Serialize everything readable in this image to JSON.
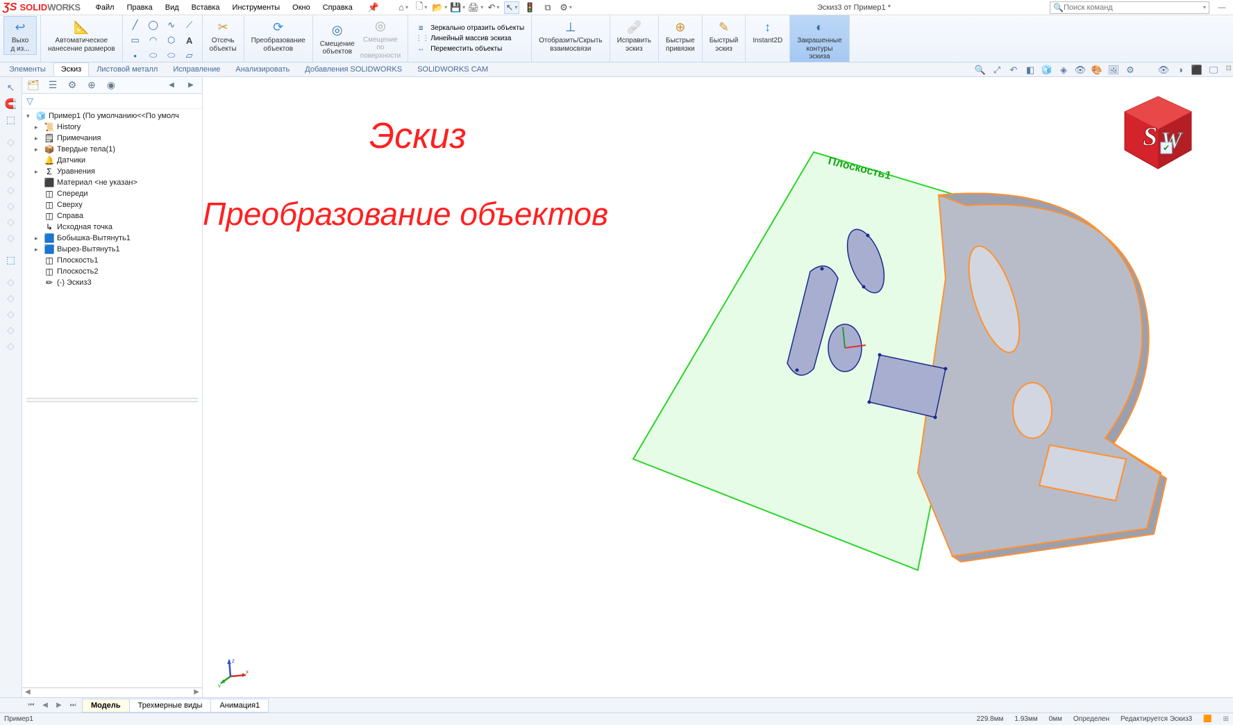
{
  "app": {
    "logo_solid": "SOLID",
    "logo_works": "WORKS"
  },
  "menu": {
    "file": "Файл",
    "edit": "Правка",
    "view": "Вид",
    "insert": "Вставка",
    "tools": "Инструменты",
    "window": "Окно",
    "help": "Справка"
  },
  "doc_title": "Эскиз3 от Пример1 *",
  "search": {
    "placeholder": "Поиск команд"
  },
  "ribbon": {
    "exit_sketch": "Выхо\nд из...",
    "smart_dim": "Автоматическое\nнанесение размеров",
    "trim": "Отсечь\nобъекты",
    "convert": "Преобразование\nобъектов",
    "offset": "Смещение\nобъектов",
    "offset_surf": "Смещение\nпо\nповерхности",
    "mirror": "Зеркально отразить объекты",
    "linear_pattern": "Линейный массив эскиза",
    "move": "Переместить объекты",
    "show_hide": "Отобразить/Скрыть\nвзаимосвязи",
    "repair": "Исправить\nэскиз",
    "quick_snaps": "Быстрые\nпривязки",
    "rapid_sketch": "Быстрый\nэскиз",
    "instant2d": "Instant2D",
    "shaded_contours": "Закрашенные\nконтуры\nэскиза"
  },
  "cmd_tabs": [
    "Элементы",
    "Эскиз",
    "Листовой металл",
    "Исправление",
    "Анализировать",
    "Добавления SOLIDWORKS",
    "SOLIDWORKS CAM"
  ],
  "active_cmd_tab": 1,
  "fm": {
    "root": "Пример1  (По умолчанию<<По умолч",
    "items": [
      {
        "icon": "📜",
        "label": "History",
        "toggle": "▸"
      },
      {
        "icon": "🗒",
        "label": "Примечания",
        "toggle": "▸"
      },
      {
        "icon": "📦",
        "label": "Твердые тела(1)",
        "toggle": "▸"
      },
      {
        "icon": "🔔",
        "label": "Датчики",
        "toggle": ""
      },
      {
        "icon": "Σ",
        "label": "Уравнения",
        "toggle": "▸"
      },
      {
        "icon": "⬛",
        "label": "Материал <не указан>",
        "toggle": ""
      },
      {
        "icon": "◫",
        "label": "Спереди",
        "toggle": ""
      },
      {
        "icon": "◫",
        "label": "Сверху",
        "toggle": ""
      },
      {
        "icon": "◫",
        "label": "Справа",
        "toggle": ""
      },
      {
        "icon": "↳",
        "label": "Исходная точка",
        "toggle": ""
      },
      {
        "icon": "🟦",
        "label": "Бобышка-Вытянуть1",
        "toggle": "▸"
      },
      {
        "icon": "🟦",
        "label": "Вырез-Вытянуть1",
        "toggle": "▸"
      },
      {
        "icon": "◫",
        "label": "Плоскость1",
        "toggle": ""
      },
      {
        "icon": "◫",
        "label": "Плоскость2",
        "toggle": ""
      },
      {
        "icon": "✏",
        "label": "(-) Эскиз3",
        "toggle": ""
      }
    ]
  },
  "overlay": {
    "title": "Эскиз",
    "subtitle": "Преобразование объектов",
    "plane_label": "Плоскость1"
  },
  "view_tabs": {
    "model": "Модель",
    "views3d": "Трехмерные виды",
    "anim": "Анимация1"
  },
  "status": {
    "left": "Пример1",
    "dist": "229.8мм",
    "dist2": "1.93мм",
    "dist3": "0мм",
    "defined": "Определен",
    "editing": "Редактируется Эскиз3"
  }
}
